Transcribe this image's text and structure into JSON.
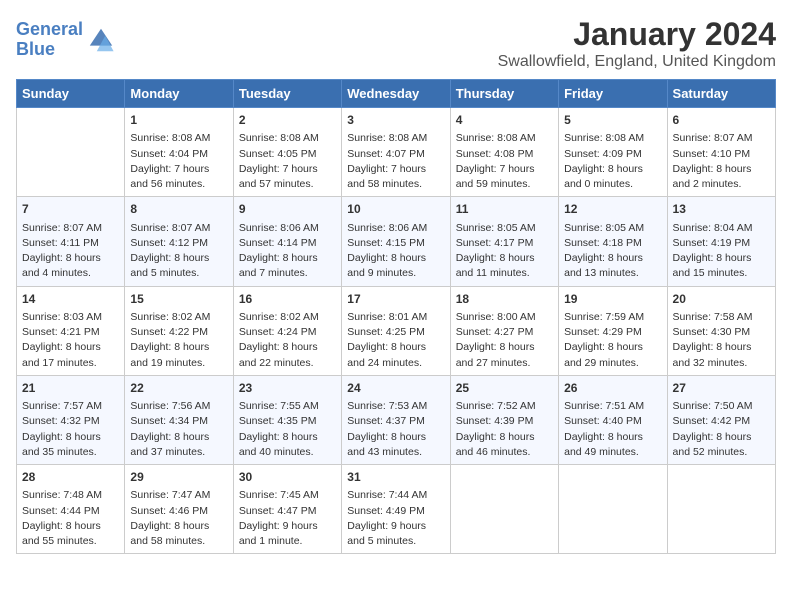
{
  "logo": {
    "line1": "General",
    "line2": "Blue"
  },
  "title": "January 2024",
  "subtitle": "Swallowfield, England, United Kingdom",
  "days_of_week": [
    "Sunday",
    "Monday",
    "Tuesday",
    "Wednesday",
    "Thursday",
    "Friday",
    "Saturday"
  ],
  "weeks": [
    [
      {
        "day": "",
        "content": ""
      },
      {
        "day": "1",
        "content": "Sunrise: 8:08 AM\nSunset: 4:04 PM\nDaylight: 7 hours\nand 56 minutes."
      },
      {
        "day": "2",
        "content": "Sunrise: 8:08 AM\nSunset: 4:05 PM\nDaylight: 7 hours\nand 57 minutes."
      },
      {
        "day": "3",
        "content": "Sunrise: 8:08 AM\nSunset: 4:07 PM\nDaylight: 7 hours\nand 58 minutes."
      },
      {
        "day": "4",
        "content": "Sunrise: 8:08 AM\nSunset: 4:08 PM\nDaylight: 7 hours\nand 59 minutes."
      },
      {
        "day": "5",
        "content": "Sunrise: 8:08 AM\nSunset: 4:09 PM\nDaylight: 8 hours\nand 0 minutes."
      },
      {
        "day": "6",
        "content": "Sunrise: 8:07 AM\nSunset: 4:10 PM\nDaylight: 8 hours\nand 2 minutes."
      }
    ],
    [
      {
        "day": "7",
        "content": "Sunrise: 8:07 AM\nSunset: 4:11 PM\nDaylight: 8 hours\nand 4 minutes."
      },
      {
        "day": "8",
        "content": "Sunrise: 8:07 AM\nSunset: 4:12 PM\nDaylight: 8 hours\nand 5 minutes."
      },
      {
        "day": "9",
        "content": "Sunrise: 8:06 AM\nSunset: 4:14 PM\nDaylight: 8 hours\nand 7 minutes."
      },
      {
        "day": "10",
        "content": "Sunrise: 8:06 AM\nSunset: 4:15 PM\nDaylight: 8 hours\nand 9 minutes."
      },
      {
        "day": "11",
        "content": "Sunrise: 8:05 AM\nSunset: 4:17 PM\nDaylight: 8 hours\nand 11 minutes."
      },
      {
        "day": "12",
        "content": "Sunrise: 8:05 AM\nSunset: 4:18 PM\nDaylight: 8 hours\nand 13 minutes."
      },
      {
        "day": "13",
        "content": "Sunrise: 8:04 AM\nSunset: 4:19 PM\nDaylight: 8 hours\nand 15 minutes."
      }
    ],
    [
      {
        "day": "14",
        "content": "Sunrise: 8:03 AM\nSunset: 4:21 PM\nDaylight: 8 hours\nand 17 minutes."
      },
      {
        "day": "15",
        "content": "Sunrise: 8:02 AM\nSunset: 4:22 PM\nDaylight: 8 hours\nand 19 minutes."
      },
      {
        "day": "16",
        "content": "Sunrise: 8:02 AM\nSunset: 4:24 PM\nDaylight: 8 hours\nand 22 minutes."
      },
      {
        "day": "17",
        "content": "Sunrise: 8:01 AM\nSunset: 4:25 PM\nDaylight: 8 hours\nand 24 minutes."
      },
      {
        "day": "18",
        "content": "Sunrise: 8:00 AM\nSunset: 4:27 PM\nDaylight: 8 hours\nand 27 minutes."
      },
      {
        "day": "19",
        "content": "Sunrise: 7:59 AM\nSunset: 4:29 PM\nDaylight: 8 hours\nand 29 minutes."
      },
      {
        "day": "20",
        "content": "Sunrise: 7:58 AM\nSunset: 4:30 PM\nDaylight: 8 hours\nand 32 minutes."
      }
    ],
    [
      {
        "day": "21",
        "content": "Sunrise: 7:57 AM\nSunset: 4:32 PM\nDaylight: 8 hours\nand 35 minutes."
      },
      {
        "day": "22",
        "content": "Sunrise: 7:56 AM\nSunset: 4:34 PM\nDaylight: 8 hours\nand 37 minutes."
      },
      {
        "day": "23",
        "content": "Sunrise: 7:55 AM\nSunset: 4:35 PM\nDaylight: 8 hours\nand 40 minutes."
      },
      {
        "day": "24",
        "content": "Sunrise: 7:53 AM\nSunset: 4:37 PM\nDaylight: 8 hours\nand 43 minutes."
      },
      {
        "day": "25",
        "content": "Sunrise: 7:52 AM\nSunset: 4:39 PM\nDaylight: 8 hours\nand 46 minutes."
      },
      {
        "day": "26",
        "content": "Sunrise: 7:51 AM\nSunset: 4:40 PM\nDaylight: 8 hours\nand 49 minutes."
      },
      {
        "day": "27",
        "content": "Sunrise: 7:50 AM\nSunset: 4:42 PM\nDaylight: 8 hours\nand 52 minutes."
      }
    ],
    [
      {
        "day": "28",
        "content": "Sunrise: 7:48 AM\nSunset: 4:44 PM\nDaylight: 8 hours\nand 55 minutes."
      },
      {
        "day": "29",
        "content": "Sunrise: 7:47 AM\nSunset: 4:46 PM\nDaylight: 8 hours\nand 58 minutes."
      },
      {
        "day": "30",
        "content": "Sunrise: 7:45 AM\nSunset: 4:47 PM\nDaylight: 9 hours\nand 1 minute."
      },
      {
        "day": "31",
        "content": "Sunrise: 7:44 AM\nSunset: 4:49 PM\nDaylight: 9 hours\nand 5 minutes."
      },
      {
        "day": "",
        "content": ""
      },
      {
        "day": "",
        "content": ""
      },
      {
        "day": "",
        "content": ""
      }
    ]
  ]
}
